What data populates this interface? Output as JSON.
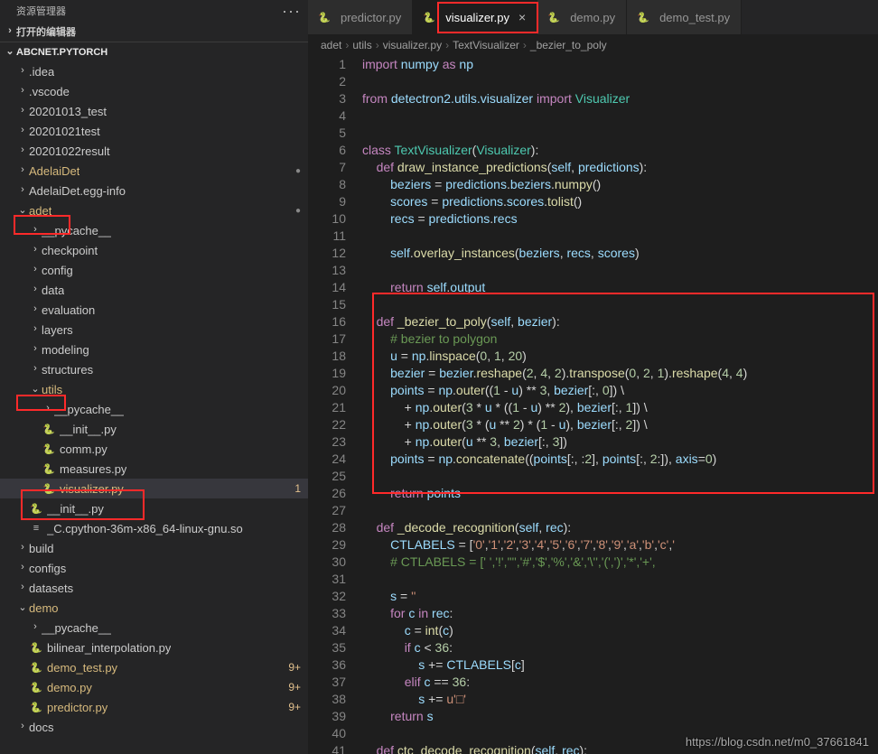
{
  "sidebar": {
    "title": "资源管理器",
    "openEditors": "打开的编辑器",
    "project": "ABCNET.PYTORCH",
    "items": [
      {
        "t": "f",
        "d": 1,
        "ch": "right",
        "label": ".idea"
      },
      {
        "t": "f",
        "d": 1,
        "ch": "right",
        "label": ".vscode"
      },
      {
        "t": "f",
        "d": 1,
        "ch": "right",
        "label": "20201013_test"
      },
      {
        "t": "f",
        "d": 1,
        "ch": "right",
        "label": "20201021test"
      },
      {
        "t": "f",
        "d": 1,
        "ch": "right",
        "label": "20201022result"
      },
      {
        "t": "f",
        "d": 1,
        "ch": "right",
        "label": "AdelaiDet",
        "mod": true,
        "dot": true
      },
      {
        "t": "f",
        "d": 1,
        "ch": "right",
        "label": "AdelaiDet.egg-info"
      },
      {
        "t": "f",
        "d": 1,
        "ch": "down",
        "label": "adet",
        "mod": true,
        "dot": true,
        "box": true
      },
      {
        "t": "f",
        "d": 2,
        "ch": "right",
        "label": "__pycache__"
      },
      {
        "t": "f",
        "d": 2,
        "ch": "right",
        "label": "checkpoint"
      },
      {
        "t": "f",
        "d": 2,
        "ch": "right",
        "label": "config"
      },
      {
        "t": "f",
        "d": 2,
        "ch": "right",
        "label": "data"
      },
      {
        "t": "f",
        "d": 2,
        "ch": "right",
        "label": "evaluation"
      },
      {
        "t": "f",
        "d": 2,
        "ch": "right",
        "label": "layers"
      },
      {
        "t": "f",
        "d": 2,
        "ch": "right",
        "label": "modeling"
      },
      {
        "t": "f",
        "d": 2,
        "ch": "right",
        "label": "structures"
      },
      {
        "t": "f",
        "d": 2,
        "ch": "down",
        "label": "utils",
        "mod": true,
        "box": true
      },
      {
        "t": "f",
        "d": 3,
        "ch": "right",
        "label": "__pycache__"
      },
      {
        "t": "py",
        "d": 3,
        "label": "__init__.py"
      },
      {
        "t": "py",
        "d": 3,
        "label": "comm.py"
      },
      {
        "t": "py",
        "d": 3,
        "label": "measures.py"
      },
      {
        "t": "py",
        "d": 3,
        "label": "visualizer.py",
        "mod": true,
        "badge": "1",
        "sel": true,
        "box": true
      },
      {
        "t": "py",
        "d": 2,
        "label": "__init__.py"
      },
      {
        "t": "bin",
        "d": 2,
        "label": "_C.cpython-36m-x86_64-linux-gnu.so"
      },
      {
        "t": "f",
        "d": 1,
        "ch": "right",
        "label": "build"
      },
      {
        "t": "f",
        "d": 1,
        "ch": "right",
        "label": "configs"
      },
      {
        "t": "f",
        "d": 1,
        "ch": "right",
        "label": "datasets"
      },
      {
        "t": "f",
        "d": 1,
        "ch": "down",
        "label": "demo",
        "mod": true
      },
      {
        "t": "f",
        "d": 2,
        "ch": "right",
        "label": "__pycache__"
      },
      {
        "t": "py",
        "d": 2,
        "label": "bilinear_interpolation.py"
      },
      {
        "t": "py",
        "d": 2,
        "label": "demo_test.py",
        "mod": true,
        "badge": "9+"
      },
      {
        "t": "py",
        "d": 2,
        "label": "demo.py",
        "mod": true,
        "badge": "9+"
      },
      {
        "t": "py",
        "d": 2,
        "label": "predictor.py",
        "mod": true,
        "badge": "9+"
      },
      {
        "t": "f",
        "d": 1,
        "ch": "right",
        "label": "docs"
      }
    ]
  },
  "tabs": [
    {
      "label": "predictor.py",
      "active": false
    },
    {
      "label": "visualizer.py",
      "active": true,
      "box": true
    },
    {
      "label": "demo.py",
      "active": false
    },
    {
      "label": "demo_test.py",
      "active": false
    }
  ],
  "breadcrumb": [
    "adet",
    "utils",
    "visualizer.py",
    "TextVisualizer",
    "_bezier_to_poly"
  ],
  "code": {
    "start": 1,
    "lines": [
      "<span class='kw'>import</span> <span class='var'>numpy</span> <span class='kw'>as</span> <span class='var'>np</span>",
      "",
      "<span class='kw'>from</span> <span class='var'>detectron2.utils.visualizer</span> <span class='kw'>import</span> <span class='cls'>Visualizer</span>",
      "",
      "",
      "<span class='kw'>class</span> <span class='cls'>TextVisualizer</span>(<span class='cls'>Visualizer</span>):",
      "    <span class='kw'>def</span> <span class='fn'>draw_instance_predictions</span>(<span class='self'>self</span>, <span class='var'>predictions</span>):",
      "        <span class='var'>beziers</span> = <span class='var'>predictions</span>.<span class='var'>beziers</span>.<span class='fn'>numpy</span>()",
      "        <span class='var'>scores</span> = <span class='var'>predictions</span>.<span class='var'>scores</span>.<span class='fn'>tolist</span>()",
      "        <span class='var'>recs</span> = <span class='var'>predictions</span>.<span class='var'>recs</span>",
      "",
      "        <span class='self'>self</span>.<span class='fn'>overlay_instances</span>(<span class='var'>beziers</span>, <span class='var'>recs</span>, <span class='var'>scores</span>)",
      "",
      "        <span class='kw'>return</span> <span class='self'>self</span>.<span class='var'>output</span>",
      "",
      "    <span class='kw'>def</span> <span class='fn'>_bezier_to_poly</span>(<span class='self'>self</span>, <span class='var'>bezier</span>):",
      "        <span class='cmt'># bezier to polygon</span>",
      "        <span class='var'>u</span> = <span class='var'>np</span>.<span class='fn'>linspace</span>(<span class='num'>0</span>, <span class='num'>1</span>, <span class='num'>20</span>)",
      "        <span class='var'>bezier</span> = <span class='var'>bezier</span>.<span class='fn'>reshape</span>(<span class='num'>2</span>, <span class='num'>4</span>, <span class='num'>2</span>).<span class='fn'>transpose</span>(<span class='num'>0</span>, <span class='num'>2</span>, <span class='num'>1</span>).<span class='fn'>reshape</span>(<span class='num'>4</span>, <span class='num'>4</span>)",
      "        <span class='var'>points</span> = <span class='var'>np</span>.<span class='fn'>outer</span>((<span class='num'>1</span> - <span class='var'>u</span>) ** <span class='num'>3</span>, <span class='var'>bezier</span>[:, <span class='num'>0</span>]) \\",
      "            + <span class='var'>np</span>.<span class='fn'>outer</span>(<span class='num'>3</span> * <span class='var'>u</span> * ((<span class='num'>1</span> - <span class='var'>u</span>) ** <span class='num'>2</span>), <span class='var'>bezier</span>[:, <span class='num'>1</span>]) \\",
      "            + <span class='var'>np</span>.<span class='fn'>outer</span>(<span class='num'>3</span> * (<span class='var'>u</span> ** <span class='num'>2</span>) * (<span class='num'>1</span> - <span class='var'>u</span>), <span class='var'>bezier</span>[:, <span class='num'>2</span>]) \\",
      "            + <span class='var'>np</span>.<span class='fn'>outer</span>(<span class='var'>u</span> ** <span class='num'>3</span>, <span class='var'>bezier</span>[:, <span class='num'>3</span>])",
      "        <span class='var'>points</span> = <span class='var'>np</span>.<span class='fn'>concatenate</span>((<span class='var'>points</span>[:, :<span class='num'>2</span>], <span class='var'>points</span>[:, <span class='num'>2</span>:]), <span class='var'>axis</span>=<span class='num'>0</span>)",
      "",
      "        <span class='kw'>return</span> <span class='var'>points</span>",
      "",
      "    <span class='kw'>def</span> <span class='fn'>_decode_recognition</span>(<span class='self'>self</span>, <span class='var'>rec</span>):",
      "        <span class='var'>CTLABELS</span> = [<span class='str'>'0'</span>,<span class='str'>'1'</span>,<span class='str'>'2'</span>,<span class='str'>'3'</span>,<span class='str'>'4'</span>,<span class='str'>'5'</span>,<span class='str'>'6'</span>,<span class='str'>'7'</span>,<span class='str'>'8'</span>,<span class='str'>'9'</span>,<span class='str'>'a'</span>,<span class='str'>'b'</span>,<span class='str'>'c'</span>,<span class='str'>'</span>",
      "        <span class='cmt'># CTLABELS = [' ','!','\"','#','$','%','&','\\'','(',')','*','+',</span>",
      "",
      "        <span class='var'>s</span> = <span class='str'>''</span>",
      "        <span class='kw'>for</span> <span class='var'>c</span> <span class='kw'>in</span> <span class='var'>rec</span>:",
      "            <span class='var'>c</span> = <span class='fn'>int</span>(<span class='var'>c</span>)",
      "            <span class='kw'>if</span> <span class='var'>c</span> &lt; <span class='num'>36</span>:",
      "                <span class='var'>s</span> += <span class='var'>CTLABELS</span>[<span class='var'>c</span>]",
      "            <span class='kw'>elif</span> <span class='var'>c</span> == <span class='num'>36</span>:",
      "                <span class='var'>s</span> += <span class='str'>u'□'</span>",
      "        <span class='kw'>return</span> <span class='var'>s</span>",
      "",
      "    <span class='kw'>def</span> <span class='fn'>ctc_decode_recognition</span>(<span class='self'>self</span>, <span class='var'>rec</span>):"
    ]
  },
  "watermark": "https://blog.csdn.net/m0_37661841"
}
